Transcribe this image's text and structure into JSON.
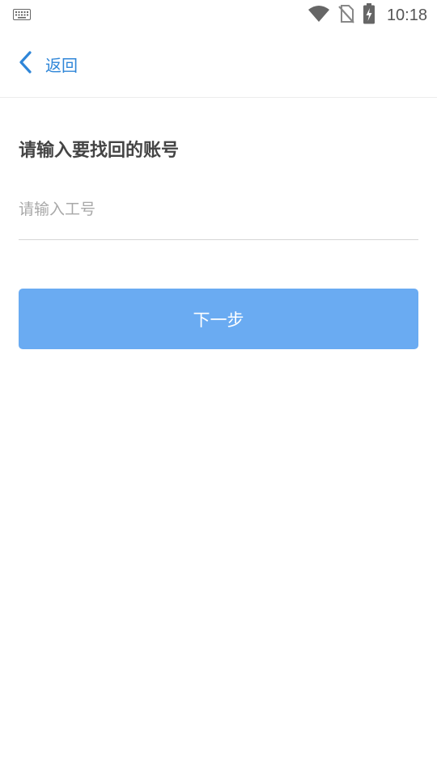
{
  "status_bar": {
    "time": "10:18",
    "icons": [
      "keyboard-icon",
      "wifi-icon",
      "no-sim-icon",
      "battery-charging-icon"
    ]
  },
  "header": {
    "back_label": "返回"
  },
  "main": {
    "title": "请输入要找回的账号",
    "input_placeholder": "请输入工号",
    "input_value": "",
    "next_label": "下一步"
  },
  "colors": {
    "accent": "#2f86d8",
    "button": "#6aabf2",
    "title_text": "#444444",
    "placeholder": "#a8a8a8"
  }
}
